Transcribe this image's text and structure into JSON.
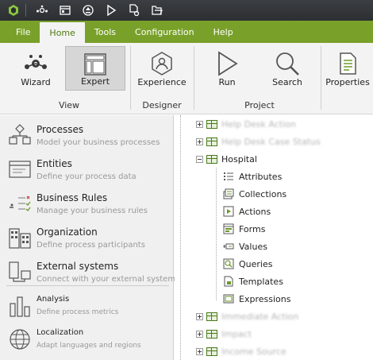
{
  "quick_access": {
    "icons": [
      "app-logo-icon",
      "process-flow-icon",
      "layout-icon",
      "upload-icon",
      "play-icon",
      "document-settings-icon",
      "open-folder-icon"
    ]
  },
  "menu": {
    "tabs": [
      "File",
      "Home",
      "Tools",
      "Configuration",
      "Help"
    ],
    "active": "Home"
  },
  "ribbon": {
    "buttons": {
      "wizard": "Wizard",
      "expert": "Expert",
      "experience": "Experience",
      "run": "Run",
      "search": "Search",
      "properties": "Properties"
    },
    "groups": {
      "view": "View",
      "designer": "Designer",
      "project": "Project"
    },
    "accent": "#79a12a"
  },
  "nav": {
    "processes": {
      "title": "Processes",
      "subtitle": "Model your business processes"
    },
    "entities": {
      "title": "Entities",
      "subtitle": "Define your process data"
    },
    "rules": {
      "title": "Business Rules",
      "subtitle": "Manage your business rules"
    },
    "organization": {
      "title": "Organization",
      "subtitle": "Define process participants"
    },
    "external": {
      "title": "External systems",
      "subtitle": "Connect with your external systems"
    },
    "analysis": {
      "title": "Analysis",
      "subtitle": "Define process metrics"
    },
    "localization": {
      "title": "Localization",
      "subtitle": "Adapt languages and regions"
    }
  },
  "tree": {
    "top_blurred": [
      "Help Desk Action",
      "Help Desk Case Status"
    ],
    "expanded": "Hospital",
    "children": [
      "Attributes",
      "Collections",
      "Actions",
      "Forms",
      "Values",
      "Queries",
      "Templates",
      "Expressions"
    ],
    "bottom_blurred": [
      "Immediate Action",
      "Impact",
      "Income Source"
    ]
  }
}
